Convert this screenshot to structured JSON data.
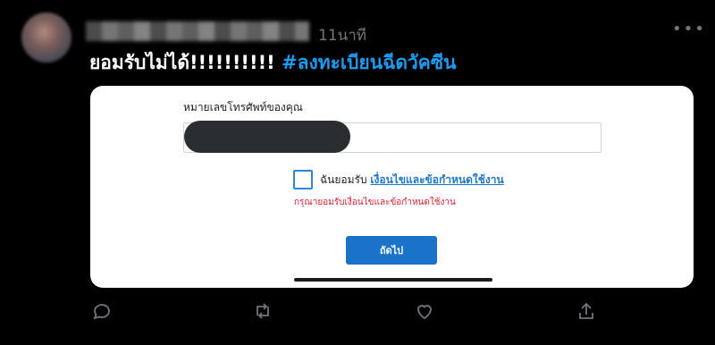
{
  "tweet": {
    "timestamp": "11นาที",
    "more_icon": "more-horizontal-icon",
    "text": "ยอมรับไม่ได้!!!!!!!!!! ",
    "hashtag": "#ลงทะเบียนฉีดวัคซีน"
  },
  "card": {
    "phone_label": "หมายเลขโทรศัพท์ของคุณ",
    "accept_prefix": "ฉันยอมรับ ",
    "terms_link": "เงื่อนไขและข้อกำหนดใช้งาน",
    "error_text": "กรุณายอมรับเงื่อนไขและข้อกำหนดใช้งาน",
    "next_button": "ถัดไป"
  },
  "actions": {
    "icons": [
      "reply-icon",
      "retweet-icon",
      "like-icon",
      "share-icon"
    ]
  },
  "colors": {
    "background": "#000000",
    "hashtag": "#1d9bf0",
    "button": "#1a73c8",
    "error": "#d6212f",
    "muted": "#71767b"
  }
}
